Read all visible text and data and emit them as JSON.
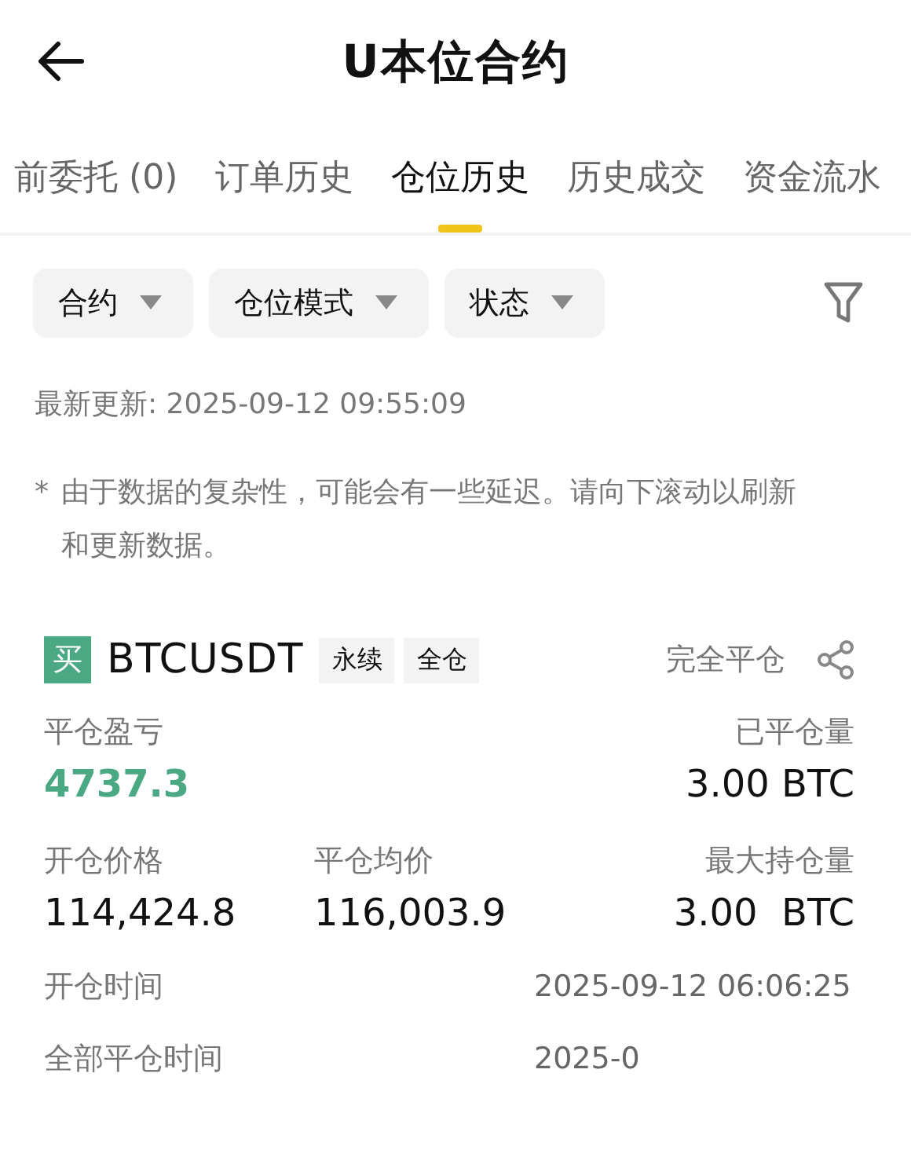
{
  "header": {
    "title": "U本位合约"
  },
  "tabs": [
    {
      "label": "前委托 (0)",
      "selected": false
    },
    {
      "label": "订单历史",
      "selected": false
    },
    {
      "label": "仓位历史",
      "selected": true
    },
    {
      "label": "历史成交",
      "selected": false
    },
    {
      "label": "资金流水",
      "selected": false
    }
  ],
  "filters": [
    "合约",
    "仓位模式",
    "状态"
  ],
  "last_update": "最新更新: 2025-09-12 09:55:09",
  "notice": {
    "mark": "*",
    "text": "由于数据的复杂性，可能会有一些延迟。请向下滚动以刷新和更新数据。"
  },
  "position": {
    "side": "买",
    "symbol": "BTCUSDT",
    "tags": [
      "永续",
      "全仓"
    ],
    "status": "完全平仓",
    "fields": [
      {
        "label": "平仓盈亏",
        "value": "4737.3",
        "kind": "profit"
      },
      {
        "label": "已平仓量",
        "value": "3.00 BTC",
        "kind": "plain"
      },
      {
        "label": "开仓价格",
        "value": "114,424.8",
        "kind": "plain"
      },
      {
        "label": "平仓均价",
        "value": "116,003.9",
        "kind": "plain"
      },
      {
        "label": "最大持仓量",
        "value": "3.00  BTC",
        "kind": "plain"
      }
    ],
    "times": [
      {
        "label": "开仓时间",
        "value": "2025-09-12 06:06:25"
      },
      {
        "label": "全部平仓时间",
        "value": "2025-0"
      }
    ]
  }
}
